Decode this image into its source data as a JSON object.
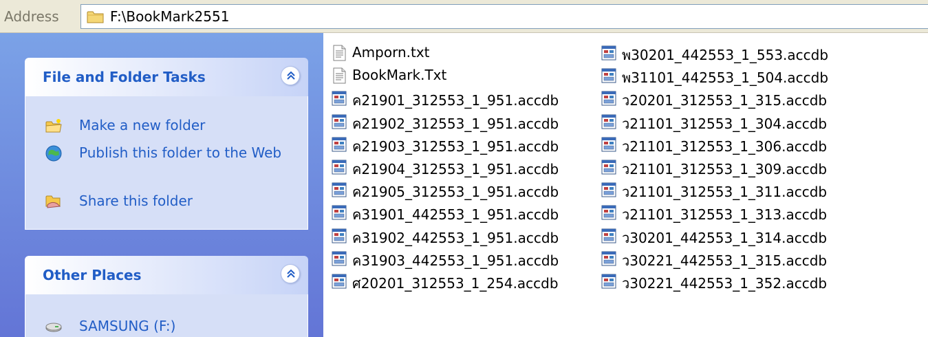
{
  "address_bar": {
    "label": "Address",
    "path": "F:\\BookMark2551",
    "icon": "folder-icon"
  },
  "task_pane": {
    "file_folder_tasks": {
      "title": "File and Folder Tasks",
      "items": [
        {
          "label": "Make a new folder",
          "icon": "new-folder-icon"
        },
        {
          "label": "Publish this folder to the Web",
          "icon": "publish-web-icon"
        },
        {
          "label": "Share this folder",
          "icon": "share-folder-icon"
        }
      ]
    },
    "other_places": {
      "title": "Other Places",
      "items": [
        {
          "label": "SAMSUNG (F:)",
          "icon": "drive-icon"
        }
      ]
    }
  },
  "files": {
    "column1": [
      {
        "name": "Amporn.txt",
        "icon": "text-file-icon"
      },
      {
        "name": "BookMark.Txt",
        "icon": "text-file-icon"
      },
      {
        "name": "ค21901_312553_1_951.accdb",
        "icon": "access-db-icon"
      },
      {
        "name": "ค21902_312553_1_951.accdb",
        "icon": "access-db-icon"
      },
      {
        "name": "ค21903_312553_1_951.accdb",
        "icon": "access-db-icon"
      },
      {
        "name": "ค21904_312553_1_951.accdb",
        "icon": "access-db-icon"
      },
      {
        "name": "ค21905_312553_1_951.accdb",
        "icon": "access-db-icon"
      },
      {
        "name": "ค31901_442553_1_951.accdb",
        "icon": "access-db-icon"
      },
      {
        "name": "ค31902_442553_1_951.accdb",
        "icon": "access-db-icon"
      },
      {
        "name": "ค31903_442553_1_951.accdb",
        "icon": "access-db-icon"
      },
      {
        "name": "ศ20201_312553_1_254.accdb",
        "icon": "access-db-icon"
      }
    ],
    "column2": [
      {
        "name": "พ30201_442553_1_553.accdb",
        "icon": "access-db-icon"
      },
      {
        "name": "พ31101_442553_1_504.accdb",
        "icon": "access-db-icon"
      },
      {
        "name": "ว20201_312553_1_315.accdb",
        "icon": "access-db-icon"
      },
      {
        "name": "ว21101_312553_1_304.accdb",
        "icon": "access-db-icon"
      },
      {
        "name": "ว21101_312553_1_306.accdb",
        "icon": "access-db-icon"
      },
      {
        "name": "ว21101_312553_1_309.accdb",
        "icon": "access-db-icon"
      },
      {
        "name": "ว21101_312553_1_311.accdb",
        "icon": "access-db-icon"
      },
      {
        "name": "ว21101_312553_1_313.accdb",
        "icon": "access-db-icon"
      },
      {
        "name": "ว30201_442553_1_314.accdb",
        "icon": "access-db-icon"
      },
      {
        "name": "ว30221_442553_1_315.accdb",
        "icon": "access-db-icon"
      },
      {
        "name": "ว30221_442553_1_352.accdb",
        "icon": "access-db-icon"
      }
    ]
  },
  "colors": {
    "task_link": "#215dc6",
    "pane_gradient_top": "#7ba2e7",
    "pane_gradient_bottom": "#6375d6",
    "panel_body": "#d6dff7",
    "address_bg": "#ece9d8"
  }
}
